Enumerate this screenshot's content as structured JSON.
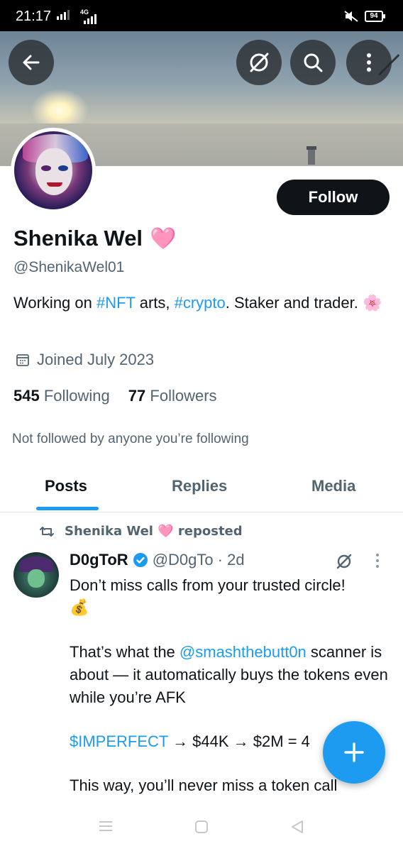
{
  "status_bar": {
    "time": "21:17",
    "network": "4G",
    "battery": "94"
  },
  "header": {
    "back_icon": "arrow-left-icon",
    "grok_icon": "grok-slash-icon",
    "search_icon": "search-icon",
    "more_icon": "more-vertical-icon"
  },
  "profile": {
    "name": "Shenika Wel",
    "name_emoji": "🩷",
    "handle": "@ShenikaWel01",
    "follow_label": "Follow",
    "bio": {
      "t1": "Working on ",
      "tag1": "#NFT",
      "t2": " arts, ",
      "tag2": "#crypto",
      "t3": ". Staker and trader. ",
      "emoji": "🌸"
    },
    "joined": "Joined July 2023",
    "following_count": "545",
    "following_label": "Following",
    "followers_count": "77",
    "followers_label": "Followers",
    "not_followed": "Not followed by anyone you’re following"
  },
  "tabs": [
    {
      "label": "Posts",
      "active": true
    },
    {
      "label": "Replies",
      "active": false
    },
    {
      "label": "Media",
      "active": false
    }
  ],
  "post": {
    "repost_text": "Shenika Wel 🩷 reposted",
    "author_name": "D0gToR",
    "author_handle": "@D0gTo",
    "time": "· 2d",
    "line1": "Don’t miss calls from your trusted circle!",
    "emoji1": "💰",
    "line2a": "That’s what the ",
    "mention": "@smashthebutt0n",
    "line2b": " scanner is about — it automatically buys the tokens even while you’re AFK",
    "cashtag": "$IMPERFECT",
    "line3": " → $44K → $2M = 4",
    "line4": "This way, you’ll never miss a token call"
  },
  "colors": {
    "accent": "#1d9bf0",
    "text": "#0f1419",
    "muted": "#536471",
    "follow_button": "#0f1419"
  }
}
